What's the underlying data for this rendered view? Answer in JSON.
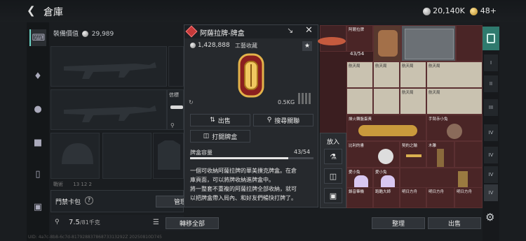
{
  "header": {
    "back_icon": "arrow-left-icon",
    "title": "倉庫",
    "silver_amount": "20,140K",
    "gold_amount": "48+"
  },
  "equipment": {
    "value_label": "裝備價值",
    "value_amount": "29,989",
    "slot_label_belt": "信標",
    "slot_label_partial": "戰術",
    "slot_numbers": "13  12  2",
    "keycard_label": "門禁卡包",
    "keycard_help": "?",
    "manage_button": "管理",
    "capacity_current": "7.5",
    "capacity_max": "/81千克",
    "transfer_all_button": "轉移全部"
  },
  "popup": {
    "title": "阿薩拉牌-牌盒",
    "price": "1,428,888",
    "tag": "工藝收藏",
    "weight": "0.5KG",
    "sell_button": "出售",
    "search_button": "搜尋關聯",
    "open_button": "打開牌盒",
    "capacity_label": "牌盒容量",
    "capacity_value": "43/54",
    "capacity_fraction": 0.796,
    "desc_line1": "一個可收納阿薩拉牌的華美撲克牌盒。在倉",
    "desc_line2": "庫頁面，可以將牌收納進牌盒中。",
    "desc_line3": "將一整套不重複的阿薩拉牌全部收納，就可",
    "desc_line4": "以把牌盒帶入局內、和好友們暢快打牌了。"
  },
  "context_menu": {
    "put_in_label": "放入"
  },
  "stash": {
    "cell_labels": [
      "阿薩拉牌",
      "航天局",
      "航天局",
      "航天局",
      "航天局",
      "航天局",
      "航天局",
      "燥火轉盤蛋黃",
      "手臂赤小兔",
      "比利的書",
      "契約之輪",
      "木雕",
      "愛小兔",
      "愛小兔",
      "錄音筆機",
      "跑酷大師",
      "明日方舟",
      "明日方舟",
      "明日方舟"
    ],
    "box_count": "43/54",
    "tidy_button": "整理",
    "sell_button": "出售"
  },
  "rightbar": {
    "tabs": [
      "I",
      "II",
      "III",
      "IV",
      "IV",
      "IV",
      "IV"
    ],
    "settings_icon": "gear-icon"
  },
  "footer": {
    "uid": "UID: 4a7c-8b8-6c7d-81792883786873313292Z  20250810D745"
  }
}
